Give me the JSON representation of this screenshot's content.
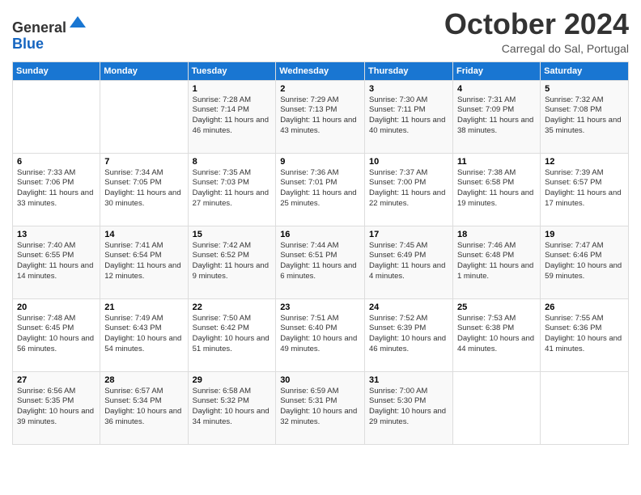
{
  "header": {
    "logo_line1": "General",
    "logo_line2": "Blue",
    "month": "October 2024",
    "location": "Carregal do Sal, Portugal"
  },
  "weekdays": [
    "Sunday",
    "Monday",
    "Tuesday",
    "Wednesday",
    "Thursday",
    "Friday",
    "Saturday"
  ],
  "weeks": [
    [
      {
        "day": "",
        "sunrise": "",
        "sunset": "",
        "daylight": ""
      },
      {
        "day": "",
        "sunrise": "",
        "sunset": "",
        "daylight": ""
      },
      {
        "day": "1",
        "sunrise": "Sunrise: 7:28 AM",
        "sunset": "Sunset: 7:14 PM",
        "daylight": "Daylight: 11 hours and 46 minutes."
      },
      {
        "day": "2",
        "sunrise": "Sunrise: 7:29 AM",
        "sunset": "Sunset: 7:13 PM",
        "daylight": "Daylight: 11 hours and 43 minutes."
      },
      {
        "day": "3",
        "sunrise": "Sunrise: 7:30 AM",
        "sunset": "Sunset: 7:11 PM",
        "daylight": "Daylight: 11 hours and 40 minutes."
      },
      {
        "day": "4",
        "sunrise": "Sunrise: 7:31 AM",
        "sunset": "Sunset: 7:09 PM",
        "daylight": "Daylight: 11 hours and 38 minutes."
      },
      {
        "day": "5",
        "sunrise": "Sunrise: 7:32 AM",
        "sunset": "Sunset: 7:08 PM",
        "daylight": "Daylight: 11 hours and 35 minutes."
      }
    ],
    [
      {
        "day": "6",
        "sunrise": "Sunrise: 7:33 AM",
        "sunset": "Sunset: 7:06 PM",
        "daylight": "Daylight: 11 hours and 33 minutes."
      },
      {
        "day": "7",
        "sunrise": "Sunrise: 7:34 AM",
        "sunset": "Sunset: 7:05 PM",
        "daylight": "Daylight: 11 hours and 30 minutes."
      },
      {
        "day": "8",
        "sunrise": "Sunrise: 7:35 AM",
        "sunset": "Sunset: 7:03 PM",
        "daylight": "Daylight: 11 hours and 27 minutes."
      },
      {
        "day": "9",
        "sunrise": "Sunrise: 7:36 AM",
        "sunset": "Sunset: 7:01 PM",
        "daylight": "Daylight: 11 hours and 25 minutes."
      },
      {
        "day": "10",
        "sunrise": "Sunrise: 7:37 AM",
        "sunset": "Sunset: 7:00 PM",
        "daylight": "Daylight: 11 hours and 22 minutes."
      },
      {
        "day": "11",
        "sunrise": "Sunrise: 7:38 AM",
        "sunset": "Sunset: 6:58 PM",
        "daylight": "Daylight: 11 hours and 19 minutes."
      },
      {
        "day": "12",
        "sunrise": "Sunrise: 7:39 AM",
        "sunset": "Sunset: 6:57 PM",
        "daylight": "Daylight: 11 hours and 17 minutes."
      }
    ],
    [
      {
        "day": "13",
        "sunrise": "Sunrise: 7:40 AM",
        "sunset": "Sunset: 6:55 PM",
        "daylight": "Daylight: 11 hours and 14 minutes."
      },
      {
        "day": "14",
        "sunrise": "Sunrise: 7:41 AM",
        "sunset": "Sunset: 6:54 PM",
        "daylight": "Daylight: 11 hours and 12 minutes."
      },
      {
        "day": "15",
        "sunrise": "Sunrise: 7:42 AM",
        "sunset": "Sunset: 6:52 PM",
        "daylight": "Daylight: 11 hours and 9 minutes."
      },
      {
        "day": "16",
        "sunrise": "Sunrise: 7:44 AM",
        "sunset": "Sunset: 6:51 PM",
        "daylight": "Daylight: 11 hours and 6 minutes."
      },
      {
        "day": "17",
        "sunrise": "Sunrise: 7:45 AM",
        "sunset": "Sunset: 6:49 PM",
        "daylight": "Daylight: 11 hours and 4 minutes."
      },
      {
        "day": "18",
        "sunrise": "Sunrise: 7:46 AM",
        "sunset": "Sunset: 6:48 PM",
        "daylight": "Daylight: 11 hours and 1 minute."
      },
      {
        "day": "19",
        "sunrise": "Sunrise: 7:47 AM",
        "sunset": "Sunset: 6:46 PM",
        "daylight": "Daylight: 10 hours and 59 minutes."
      }
    ],
    [
      {
        "day": "20",
        "sunrise": "Sunrise: 7:48 AM",
        "sunset": "Sunset: 6:45 PM",
        "daylight": "Daylight: 10 hours and 56 minutes."
      },
      {
        "day": "21",
        "sunrise": "Sunrise: 7:49 AM",
        "sunset": "Sunset: 6:43 PM",
        "daylight": "Daylight: 10 hours and 54 minutes."
      },
      {
        "day": "22",
        "sunrise": "Sunrise: 7:50 AM",
        "sunset": "Sunset: 6:42 PM",
        "daylight": "Daylight: 10 hours and 51 minutes."
      },
      {
        "day": "23",
        "sunrise": "Sunrise: 7:51 AM",
        "sunset": "Sunset: 6:40 PM",
        "daylight": "Daylight: 10 hours and 49 minutes."
      },
      {
        "day": "24",
        "sunrise": "Sunrise: 7:52 AM",
        "sunset": "Sunset: 6:39 PM",
        "daylight": "Daylight: 10 hours and 46 minutes."
      },
      {
        "day": "25",
        "sunrise": "Sunrise: 7:53 AM",
        "sunset": "Sunset: 6:38 PM",
        "daylight": "Daylight: 10 hours and 44 minutes."
      },
      {
        "day": "26",
        "sunrise": "Sunrise: 7:55 AM",
        "sunset": "Sunset: 6:36 PM",
        "daylight": "Daylight: 10 hours and 41 minutes."
      }
    ],
    [
      {
        "day": "27",
        "sunrise": "Sunrise: 6:56 AM",
        "sunset": "Sunset: 5:35 PM",
        "daylight": "Daylight: 10 hours and 39 minutes."
      },
      {
        "day": "28",
        "sunrise": "Sunrise: 6:57 AM",
        "sunset": "Sunset: 5:34 PM",
        "daylight": "Daylight: 10 hours and 36 minutes."
      },
      {
        "day": "29",
        "sunrise": "Sunrise: 6:58 AM",
        "sunset": "Sunset: 5:32 PM",
        "daylight": "Daylight: 10 hours and 34 minutes."
      },
      {
        "day": "30",
        "sunrise": "Sunrise: 6:59 AM",
        "sunset": "Sunset: 5:31 PM",
        "daylight": "Daylight: 10 hours and 32 minutes."
      },
      {
        "day": "31",
        "sunrise": "Sunrise: 7:00 AM",
        "sunset": "Sunset: 5:30 PM",
        "daylight": "Daylight: 10 hours and 29 minutes."
      },
      {
        "day": "",
        "sunrise": "",
        "sunset": "",
        "daylight": ""
      },
      {
        "day": "",
        "sunrise": "",
        "sunset": "",
        "daylight": ""
      }
    ]
  ]
}
